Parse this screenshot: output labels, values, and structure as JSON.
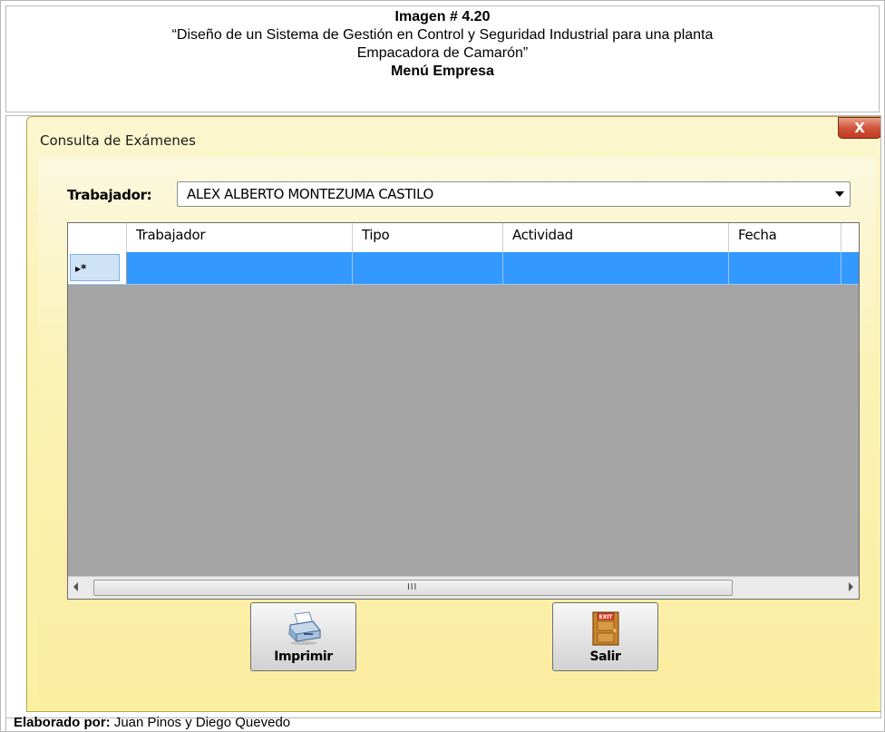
{
  "caption": {
    "label": "Imagen # 4.20",
    "title_line1": "“Diseño de un Sistema de Gestión en Control y Seguridad Industrial para una planta",
    "title_line2": "Empacadora de Camarón”",
    "subtitle": "Menú Empresa"
  },
  "window": {
    "title": "Consulta de Exámenes",
    "close_label": "X"
  },
  "filter": {
    "label": "Trabajador:",
    "selected": "ALEX ALBERTO MONTEZUMA CASTILO"
  },
  "grid": {
    "columns": [
      "Trabajador",
      "Tipo",
      "Actividad",
      "Fecha"
    ],
    "new_row_marker": "▸*",
    "scroll_grip": "III"
  },
  "buttons": {
    "print": "Imprimir",
    "exit": "Salir",
    "exit_sign": "EXIT"
  },
  "footer": {
    "label": "Elaborado por:",
    "authors": "Juan Pinos y Diego Quevedo"
  },
  "colors": {
    "window_bg": "#fbf2b6",
    "selected_row": "#3399ff",
    "grid_bg": "#a5a5a5",
    "close_button": "#c84a30"
  }
}
